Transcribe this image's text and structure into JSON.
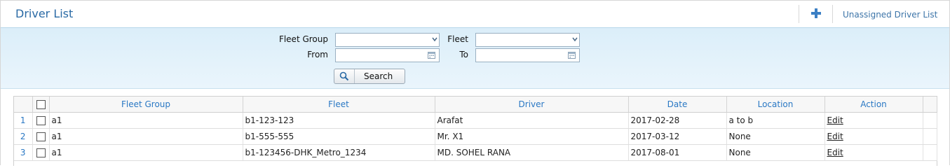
{
  "page": {
    "title": "Driver List"
  },
  "toolbar": {
    "add_icon": "plus-icon",
    "unassigned_label": "Unassigned Driver List",
    "accent": "#3b7fc4"
  },
  "filters": {
    "fleet_group_label": "Fleet Group",
    "fleet_group_value": "",
    "fleet_label": "Fleet",
    "fleet_value": "",
    "from_label": "From",
    "from_value": "",
    "to_label": "To",
    "to_value": "",
    "search_label": "Search"
  },
  "table": {
    "headers": {
      "fleet_group": "Fleet Group",
      "fleet": "Fleet",
      "driver": "Driver",
      "date": "Date",
      "location": "Location",
      "action": "Action"
    },
    "rows": [
      {
        "num": "1",
        "fleet_group": "a1",
        "fleet": "b1-123-123",
        "driver": "Arafat",
        "date": "2017-02-28",
        "location": "a to b",
        "action": "Edit"
      },
      {
        "num": "2",
        "fleet_group": "a1",
        "fleet": "b1-555-555",
        "driver": "Mr. X1",
        "date": "2017-03-12",
        "location": "None",
        "action": "Edit"
      },
      {
        "num": "3",
        "fleet_group": "a1",
        "fleet": "b1-123456-DHK_Metro_1234",
        "driver": "MD. SOHEL RANA",
        "date": "2017-08-01",
        "location": "None",
        "action": "Edit"
      }
    ]
  }
}
